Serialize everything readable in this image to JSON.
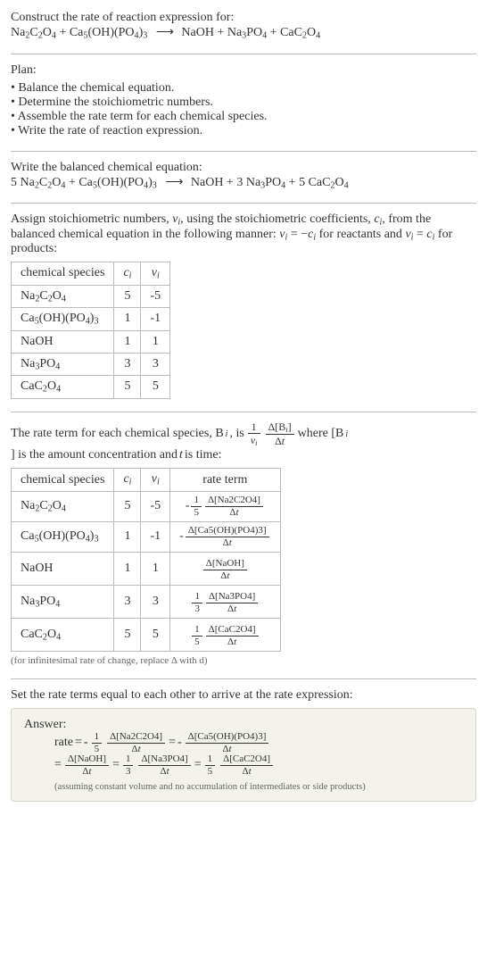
{
  "title_line": "Construct the rate of reaction expression for:",
  "unbalanced_eq": {
    "lhs": [
      "Na₂C₂O₄",
      "Ca₅(OH)(PO₄)₃"
    ],
    "rhs": [
      "NaOH",
      "Na₃PO₄",
      "CaC₂O₄"
    ]
  },
  "plan_label": "Plan:",
  "plan_items": [
    "Balance the chemical equation.",
    "Determine the stoichiometric numbers.",
    "Assemble the rate term for each chemical species.",
    "Write the rate of reaction expression."
  ],
  "balanced_label": "Write the balanced chemical equation:",
  "balanced_eq": {
    "lhs": [
      {
        "coef": "5",
        "formula": "Na₂C₂O₄"
      },
      {
        "coef": "",
        "formula": "Ca₅(OH)(PO₄)₃"
      }
    ],
    "rhs": [
      {
        "coef": "",
        "formula": "NaOH"
      },
      {
        "coef": "3",
        "formula": "Na₃PO₄"
      },
      {
        "coef": "5",
        "formula": "CaC₂O₄"
      }
    ]
  },
  "stoich_intro_a": "Assign stoichiometric numbers, ",
  "stoich_intro_b": ", using the stoichiometric coefficients, ",
  "stoich_intro_c": ", from the balanced chemical equation in the following manner: ",
  "stoich_intro_d": " for reactants and ",
  "stoich_intro_e": " for products:",
  "table1_headers": [
    "chemical species",
    "cᵢ",
    "νᵢ"
  ],
  "table1_rows": [
    {
      "species": "Na₂C₂O₄",
      "ci": "5",
      "vi": "-5"
    },
    {
      "species": "Ca₅(OH)(PO₄)₃",
      "ci": "1",
      "vi": "-1"
    },
    {
      "species": "NaOH",
      "ci": "1",
      "vi": "1"
    },
    {
      "species": "Na₃PO₄",
      "ci": "3",
      "vi": "3"
    },
    {
      "species": "CaC₂O₄",
      "ci": "5",
      "vi": "5"
    }
  ],
  "rate_term_intro_a": "The rate term for each chemical species, B",
  "rate_term_intro_b": ", is ",
  "rate_term_intro_c": " where [B",
  "rate_term_intro_d": "] is the amount concentration and ",
  "rate_term_intro_e": " is time:",
  "table2_headers": [
    "chemical species",
    "cᵢ",
    "νᵢ",
    "rate term"
  ],
  "table2_rows": [
    {
      "species": "Na₂C₂O₄",
      "ci": "5",
      "vi": "-5",
      "neg": "-",
      "coef_num": "1",
      "coef_den": "5",
      "d_sp": "Na2C2O4"
    },
    {
      "species": "Ca₅(OH)(PO₄)₃",
      "ci": "1",
      "vi": "-1",
      "neg": "-",
      "coef_num": "",
      "coef_den": "",
      "d_sp": "Ca5(OH)(PO4)3"
    },
    {
      "species": "NaOH",
      "ci": "1",
      "vi": "1",
      "neg": "",
      "coef_num": "",
      "coef_den": "",
      "d_sp": "NaOH"
    },
    {
      "species": "Na₃PO₄",
      "ci": "3",
      "vi": "3",
      "neg": "",
      "coef_num": "1",
      "coef_den": "3",
      "d_sp": "Na3PO4"
    },
    {
      "species": "CaC₂O₄",
      "ci": "5",
      "vi": "5",
      "neg": "",
      "coef_num": "1",
      "coef_den": "5",
      "d_sp": "CaC2O4"
    }
  ],
  "infinitesimal_note": "(for infinitesimal rate of change, replace Δ with d)",
  "final_intro": "Set the rate terms equal to each other to arrive at the rate expression:",
  "answer_label": "Answer:",
  "rate_label": "rate",
  "eq_sign": "=",
  "final_terms": [
    {
      "neg": "-",
      "coef_num": "1",
      "coef_den": "5",
      "d_sp": "Na2C2O4"
    },
    {
      "neg": "-",
      "coef_num": "",
      "coef_den": "",
      "d_sp": "Ca5(OH)(PO4)3"
    },
    {
      "neg": "",
      "coef_num": "",
      "coef_den": "",
      "d_sp": "NaOH"
    },
    {
      "neg": "",
      "coef_num": "1",
      "coef_den": "3",
      "d_sp": "Na3PO4"
    },
    {
      "neg": "",
      "coef_num": "1",
      "coef_den": "5",
      "d_sp": "CaC2O4"
    }
  ],
  "assumption_note": "(assuming constant volume and no accumulation of intermediates or side products)",
  "sym": {
    "nu_i": "νᵢ",
    "c_i": "cᵢ",
    "t": "t",
    "delta": "Δ",
    "delta_t": "Δt",
    "i": "i",
    "one": "1"
  },
  "chart_data": {
    "type": "table",
    "stoichiometry": [
      {
        "species": "Na2C2O4",
        "c_i": 5,
        "nu_i": -5
      },
      {
        "species": "Ca5(OH)(PO4)3",
        "c_i": 1,
        "nu_i": -1
      },
      {
        "species": "NaOH",
        "c_i": 1,
        "nu_i": 1
      },
      {
        "species": "Na3PO4",
        "c_i": 3,
        "nu_i": 3
      },
      {
        "species": "CaC2O4",
        "c_i": 5,
        "nu_i": 5
      }
    ],
    "balanced_equation": "5 Na2C2O4 + Ca5(OH)(PO4)3 -> NaOH + 3 Na3PO4 + 5 CaC2O4",
    "rate_expression": "rate = -(1/5) d[Na2C2O4]/dt = - d[Ca5(OH)(PO4)3]/dt = d[NaOH]/dt = (1/3) d[Na3PO4]/dt = (1/5) d[CaC2O4]/dt"
  }
}
